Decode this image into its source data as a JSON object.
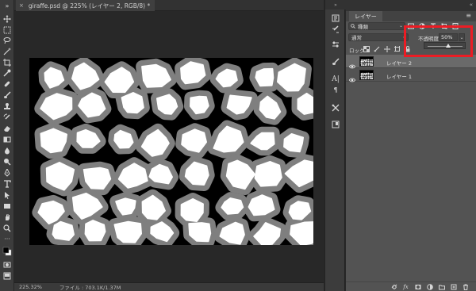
{
  "document": {
    "tab_title": "giraffe.psd @ 225% (レイヤー 2, RGB/8) *",
    "close_glyph": "×"
  },
  "status": {
    "zoom": "225.32%",
    "file_info": "ファイル : 703.1K/1.37M"
  },
  "panel": {
    "tab_label": "レイヤー",
    "menu_glyph": "≡",
    "collapse_glyph": "«",
    "filter": {
      "kind_label": "種類",
      "chevron": "⌄"
    },
    "blend": {
      "mode": "通常",
      "chevron": "⌄"
    },
    "opacity": {
      "label": "不透明度 :",
      "value": "50%",
      "chevron": "⌄",
      "slider_fraction": 0.6
    },
    "lock": {
      "label": "ロック :"
    },
    "layers": [
      {
        "name": "レイヤー 2",
        "selected": true,
        "visible": true
      },
      {
        "name": "レイヤー 1",
        "selected": false,
        "visible": true
      }
    ],
    "footer_icons": [
      "link-icon",
      "fx-icon",
      "add-mask-icon",
      "adjustment-icon",
      "group-folder-icon",
      "new-layer-icon",
      "trash-icon"
    ]
  },
  "strip": {
    "collapse_glyph": "»"
  },
  "colors": {
    "panel_bg": "#535353",
    "selected_layer": "#6a6a6a",
    "highlight_red": "#ec1c24",
    "canvas_bg": "#000000",
    "spot_fill": "#ffffff",
    "spot_border": "#7f7f7f"
  }
}
